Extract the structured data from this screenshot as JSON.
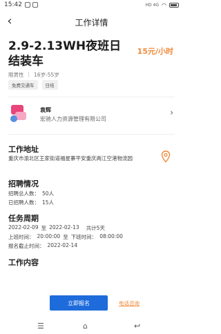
{
  "status_bar": {
    "time": "15:42",
    "network_label": "HD 4G",
    "icons": [
      "notification-icon",
      "image-icon",
      "wifi-icon",
      "battery-icon"
    ]
  },
  "nav": {
    "title": "工作详情",
    "back_icon": "back-arrow-icon"
  },
  "job": {
    "title": "2.9-2.13WH夜班日结装车",
    "salary": "15元/小时",
    "gender": "限男性",
    "separator": "|",
    "age": "16岁-55岁",
    "tags": [
      "免费交通车",
      "日结"
    ]
  },
  "company": {
    "short_name": "袁辉",
    "full_name": "宏驰人力资源管理有限公司",
    "logo_colors": [
      "#e8457a",
      "#f6a7c4",
      "#5a8ee0"
    ]
  },
  "work_address": {
    "heading": "工作地址",
    "address": "重庆市渝北区王家街道福星寨平安重庆两江空港物流园",
    "icon": "location-pin-icon"
  },
  "recruitment": {
    "heading": "招聘情况",
    "total_label": "招聘总人数：",
    "total_value": "50人",
    "hired_label": "已招聘人数：",
    "hired_value": "15人"
  },
  "period": {
    "heading": "任务周期",
    "start_date": "2022-02-09",
    "to": "至",
    "end_date": "2022-02-13",
    "days": "共计5天",
    "on_label": "上班时间：",
    "on_time": "20:00:00",
    "to2": "至",
    "off_label": "下班时间：",
    "off_time": "08:00:00",
    "deadline_label": "报名截止时间：",
    "deadline": "2022-02-14"
  },
  "content": {
    "heading": "工作内容"
  },
  "actions": {
    "apply": "立即报名",
    "call": "电话咨询"
  },
  "colors": {
    "accent_orange": "#f08a3a",
    "primary_blue": "#1e6bdb"
  },
  "system_nav": [
    "menu-icon",
    "home-icon",
    "back-icon"
  ]
}
